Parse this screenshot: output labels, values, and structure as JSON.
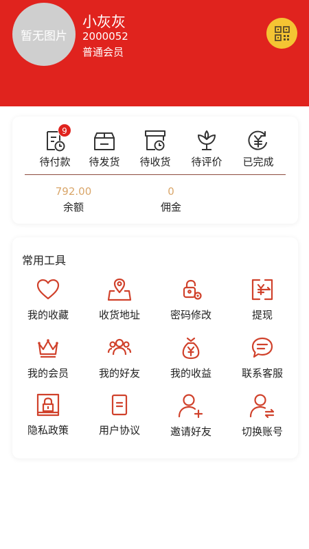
{
  "profile": {
    "avatar_text": "暂无图片",
    "name": "小灰灰",
    "id": "2000052",
    "level": "普通会员",
    "qr_icon": "qr-code-icon"
  },
  "colors": {
    "brand_red": "#e0231e",
    "accent_gold": "#f4c433",
    "money_text": "#d9a66a",
    "icon_red": "#d0412b"
  },
  "orders": {
    "items": [
      {
        "label": "待付款",
        "icon": "pending-payment-icon",
        "badge": "9"
      },
      {
        "label": "待发货",
        "icon": "pending-shipment-icon"
      },
      {
        "label": "待收货",
        "icon": "pending-receipt-icon"
      },
      {
        "label": "待评价",
        "icon": "pending-review-icon"
      },
      {
        "label": "已完成",
        "icon": "completed-icon"
      }
    ]
  },
  "wallet": {
    "balance_value": "792.00",
    "balance_label": "余额",
    "commission_value": "0",
    "commission_label": "佣金"
  },
  "tools": {
    "title": "常用工具",
    "items": [
      {
        "label": "我的收藏",
        "icon": "heart-icon"
      },
      {
        "label": "收货地址",
        "icon": "map-pin-icon"
      },
      {
        "label": "密码修改",
        "icon": "lock-gear-icon"
      },
      {
        "label": "提现",
        "icon": "withdraw-icon"
      },
      {
        "label": "我的会员",
        "icon": "crown-icon"
      },
      {
        "label": "我的好友",
        "icon": "friends-icon"
      },
      {
        "label": "我的收益",
        "icon": "money-bag-icon"
      },
      {
        "label": "联系客服",
        "icon": "chat-icon"
      },
      {
        "label": "隐私政策",
        "icon": "privacy-lock-icon"
      },
      {
        "label": "用户协议",
        "icon": "document-icon"
      },
      {
        "label": "邀请好友",
        "icon": "add-user-icon"
      },
      {
        "label": "切换账号",
        "icon": "switch-user-icon"
      }
    ]
  }
}
